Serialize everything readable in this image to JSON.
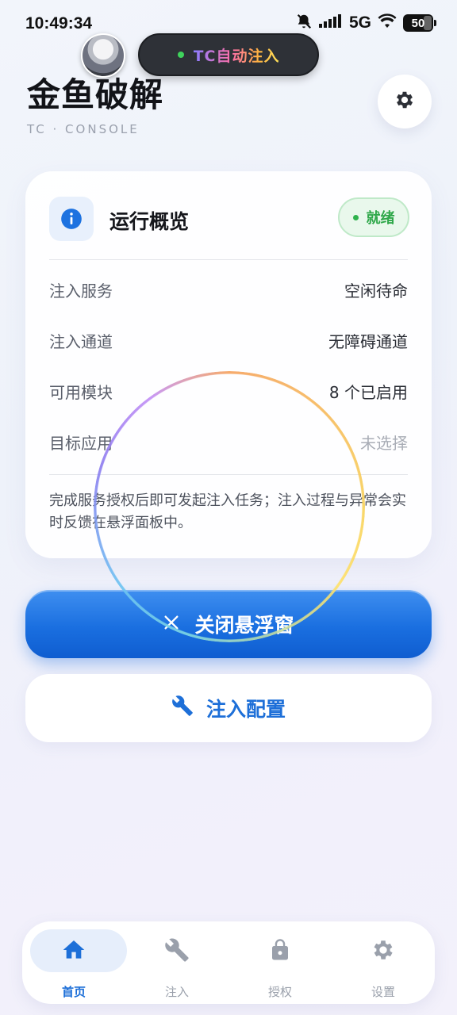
{
  "status_bar": {
    "time": "10:49:34",
    "network": "5G",
    "battery": "50"
  },
  "floating_pill": {
    "label": "TC自动注入"
  },
  "header": {
    "title": "金鱼破解",
    "subtitle": "TC · CONSOLE"
  },
  "card": {
    "title": "运行概览",
    "status_badge": "就绪",
    "rows": [
      {
        "key": "注入服务",
        "value": "空闲待命"
      },
      {
        "key": "注入通道",
        "value": "无障碍通道"
      },
      {
        "key": "可用模块",
        "value": "8 个已启用"
      },
      {
        "key": "目标应用",
        "value": "未选择"
      }
    ],
    "note": "完成服务授权后即可发起注入任务；注入过程与异常会实时反馈在悬浮面板中。"
  },
  "actions": {
    "close_overlay": "关闭悬浮窗",
    "inject_config": "注入配置"
  },
  "nav": {
    "items": [
      {
        "label": "首页",
        "icon": "home-icon"
      },
      {
        "label": "注入",
        "icon": "wrench-icon"
      },
      {
        "label": "授权",
        "icon": "lock-icon"
      },
      {
        "label": "设置",
        "icon": "gear-icon"
      }
    ]
  },
  "colors": {
    "accent": "#1D6FD8",
    "ready": "#2FA84A",
    "primary_button": "#1A6FE0"
  }
}
